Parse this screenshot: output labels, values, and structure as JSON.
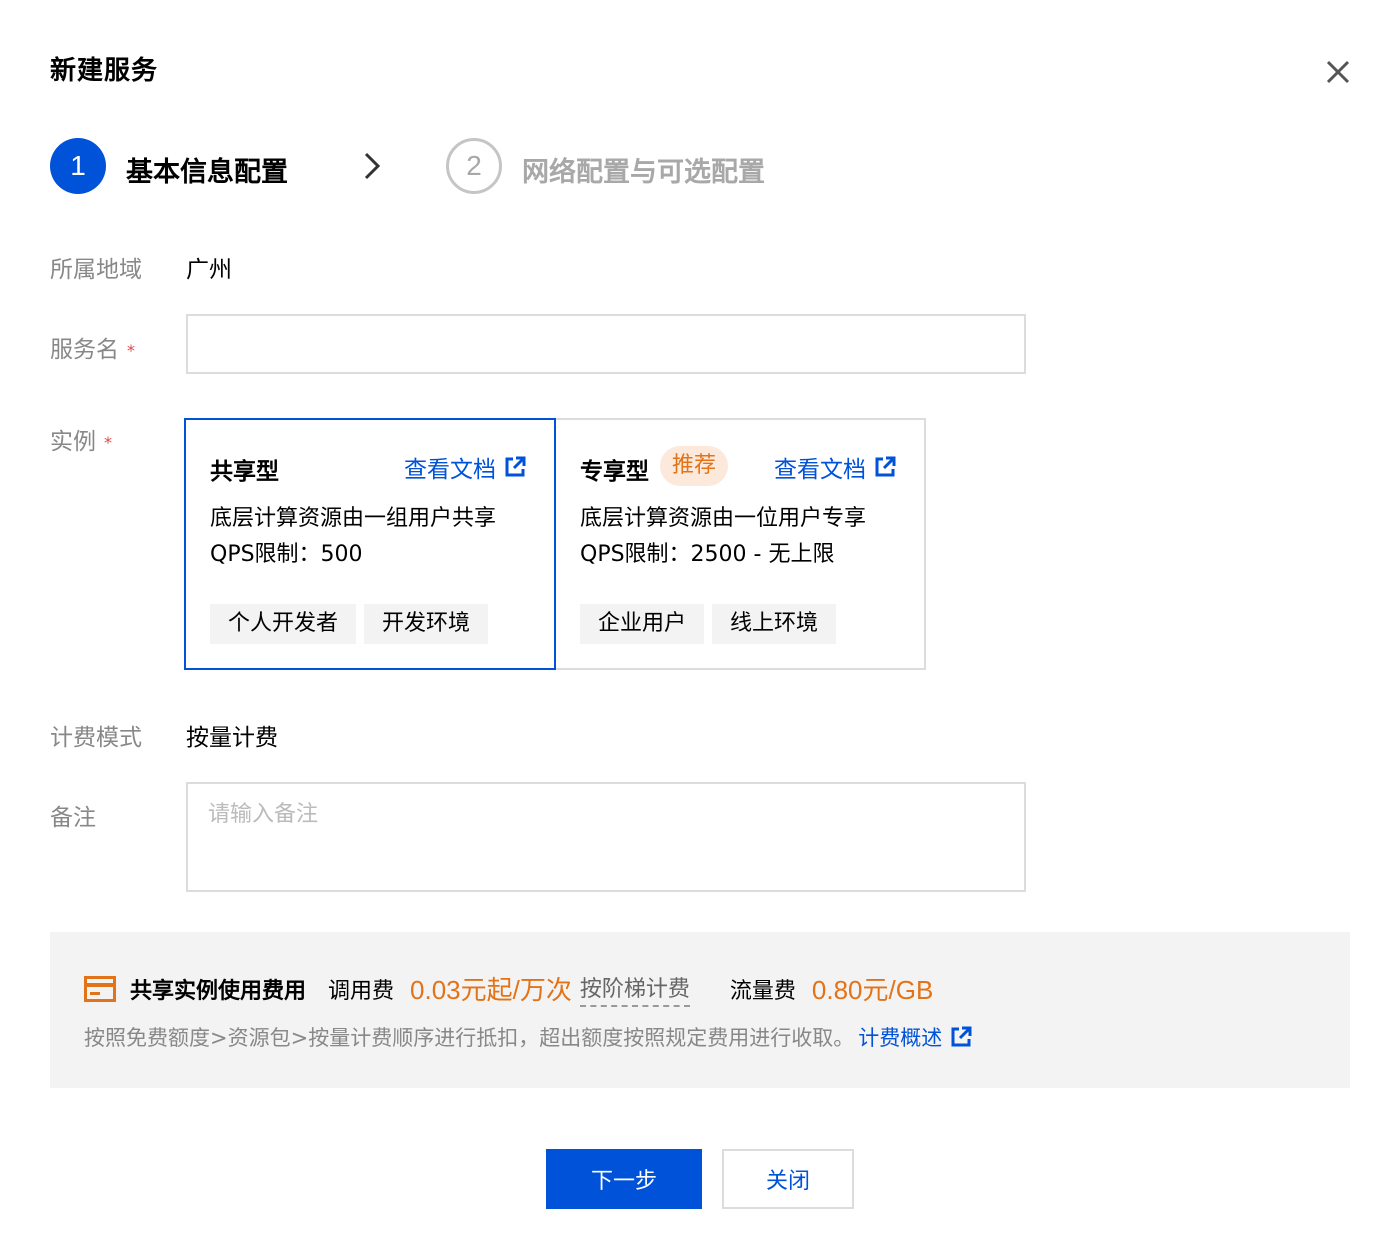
{
  "dialog": {
    "title": "新建服务",
    "close_icon": "close-icon"
  },
  "steps": [
    {
      "number": "1",
      "label": "基本信息配置",
      "state": "active"
    },
    {
      "number": "2",
      "label": "网络配置与可选配置",
      "state": "inactive"
    }
  ],
  "form": {
    "region": {
      "label": "所属地域",
      "value": "广州"
    },
    "service_name": {
      "label": "服务名",
      "required_mark": "*",
      "value": "",
      "placeholder": ""
    },
    "instance": {
      "label": "实例",
      "required_mark": "*",
      "cards": [
        {
          "title": "共享型",
          "doc_link": "查看文档",
          "description": "底层计算资源由一组用户共享",
          "qps": "QPS限制：500",
          "tags": [
            "个人开发者",
            "开发环境"
          ],
          "selected": true
        },
        {
          "title": "专享型",
          "badge": "推荐",
          "doc_link": "查看文档",
          "description": "底层计算资源由一位用户专享",
          "qps": "QPS限制：2500 - 无上限",
          "tags": [
            "企业用户",
            "线上环境"
          ],
          "selected": false
        }
      ]
    },
    "billing_mode": {
      "label": "计费模式",
      "value": "按量计费"
    },
    "remark": {
      "label": "备注",
      "value": "",
      "placeholder": "请输入备注"
    }
  },
  "fee": {
    "title": "共享实例使用费用",
    "call_fee_label": "调用费",
    "call_fee_price": "0.03元起/万次",
    "tier_link": "按阶梯计费",
    "traffic_fee_label": "流量费",
    "traffic_fee_price": "0.80元/GB",
    "note": "按照免费额度>资源包>按量计费顺序进行抵扣，超出额度按照规定费用进行收取。",
    "overview_link": "计费概述"
  },
  "footer": {
    "next_label": "下一步",
    "close_label": "关闭"
  },
  "colors": {
    "primary": "#0052d9",
    "accent_orange": "#e37318",
    "required": "#e54545",
    "badge_bg": "#fde8dc"
  }
}
